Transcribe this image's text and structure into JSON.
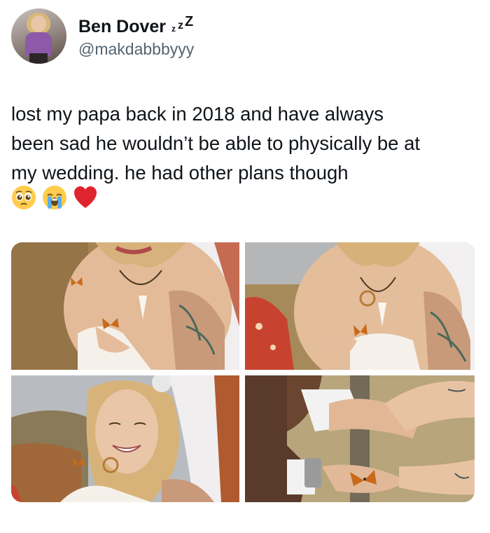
{
  "author": {
    "display_name": "Ben Dover",
    "status_emoji": "zzz-sleep",
    "handle": "@makdabbbyyy"
  },
  "tweet": {
    "lines": [
      "lost my papa back in 2018 and have always",
      "been sad he wouldn’t be able to physically be at",
      "my wedding. he had other plans though"
    ],
    "emojis": [
      "pleading-face",
      "loudly-crying-face",
      "red-heart"
    ]
  },
  "media": {
    "photos": [
      {
        "subject": "bride-smiling-butterfly-on-hand"
      },
      {
        "subject": "bride-holding-butterfly-closeup"
      },
      {
        "subject": "bride-laughing-butterfly-on-shoulder"
      },
      {
        "subject": "hands-holding-butterfly"
      }
    ]
  },
  "colors": {
    "text": "#0f1419",
    "secondary_text": "#536471",
    "heart": "#e0242e"
  }
}
